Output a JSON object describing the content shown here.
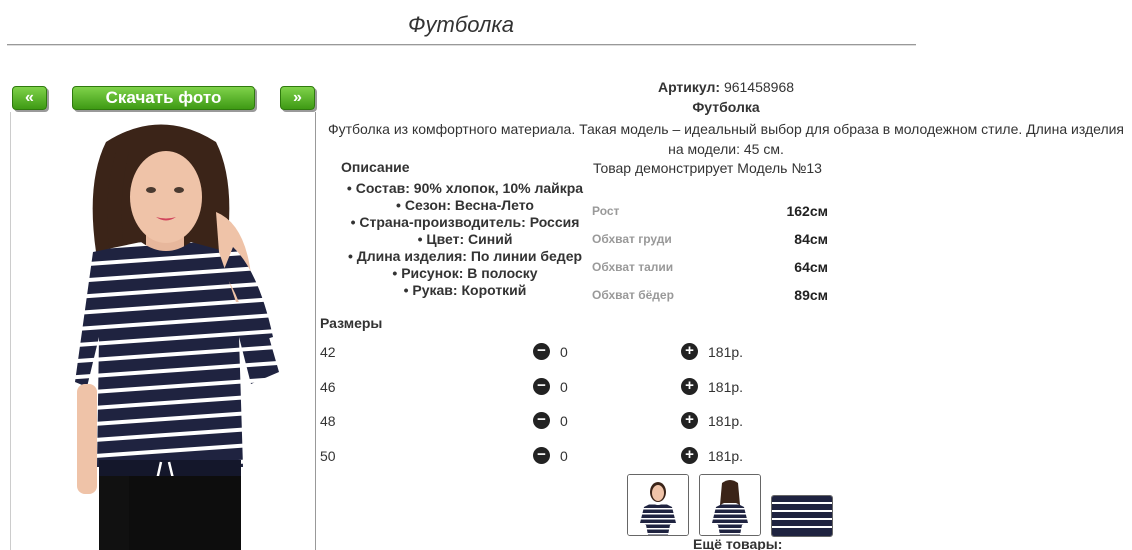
{
  "page": {
    "title": "Футболка"
  },
  "nav": {
    "prev_label": "«",
    "download_label": "Скачать фото",
    "next_label": "»"
  },
  "product": {
    "article_label": "Артикул:",
    "article_value": "961458968",
    "name": "Футболка",
    "description": "Футболка из комфортного материала. Такая модель – идеальный выбор для образа в молодежном стиле. Длина изделия на модели: 45 см.",
    "description_heading": "Описание",
    "attributes": [
      "Состав: 90% хлопок, 10% лайкра",
      "Сезон: Весна-Лето",
      "Страна-производитель: Россия",
      "Цвет: Синий",
      "Длина изделия: По линии бедер",
      "Рисунок: В полоску",
      "Рукав: Короткий"
    ],
    "stripe_color": "#1f2340"
  },
  "model": {
    "heading": "Товар демонстрирует Модель №13",
    "params": [
      {
        "label": "Рост",
        "value": "162см"
      },
      {
        "label": "Обхват груди",
        "value": "84см"
      },
      {
        "label": "Обхват талии",
        "value": "64см"
      },
      {
        "label": "Обхват бёдер",
        "value": "89см"
      }
    ]
  },
  "sizes": {
    "heading": "Размеры",
    "rows": [
      {
        "size": "42",
        "qty": "0",
        "price": "181р."
      },
      {
        "size": "46",
        "qty": "0",
        "price": "181р."
      },
      {
        "size": "48",
        "qty": "0",
        "price": "181р."
      },
      {
        "size": "50",
        "qty": "0",
        "price": "181р."
      }
    ],
    "minus_icon": "minus-circle-icon",
    "plus_icon": "plus-circle-icon"
  },
  "more": {
    "label": "Ещё товары:"
  },
  "colors": {
    "button_green": "#4caf1f"
  }
}
